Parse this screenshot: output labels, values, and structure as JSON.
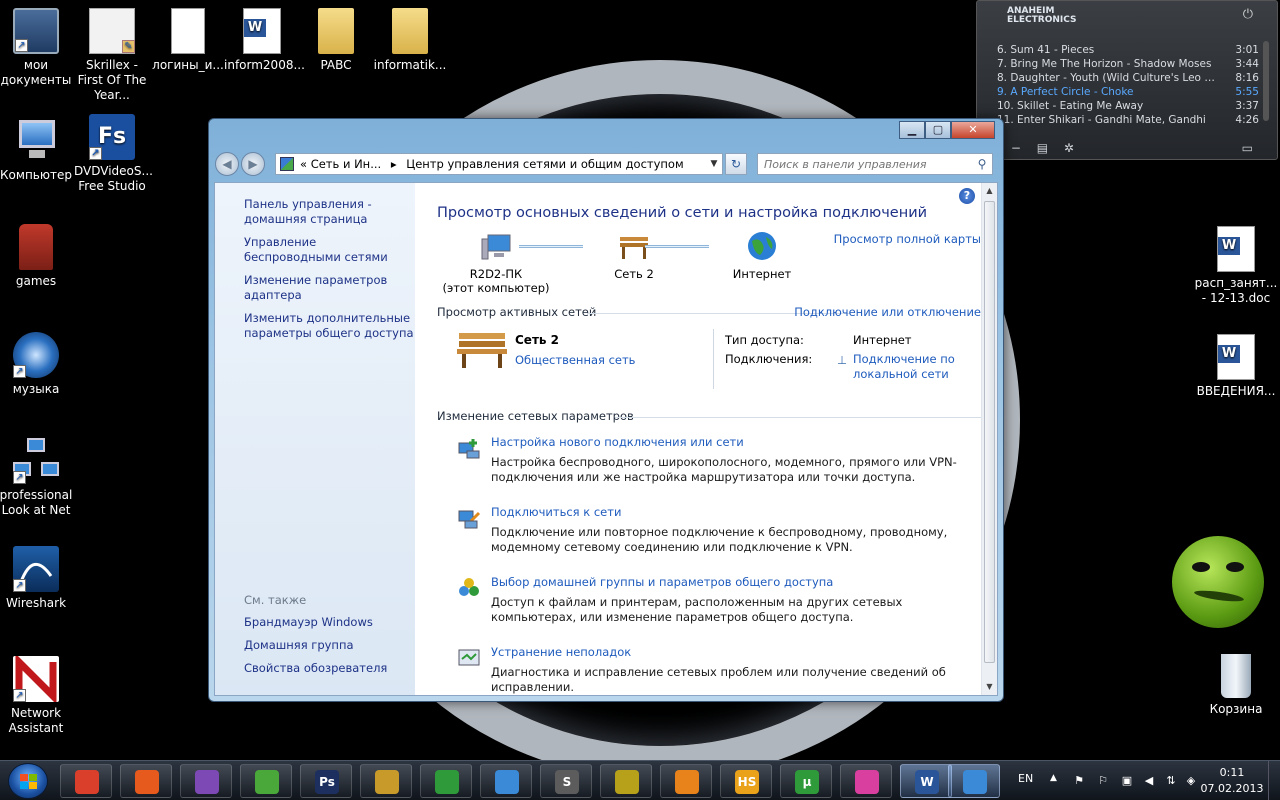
{
  "desktop": {
    "left_icons": [
      {
        "label": "мои документы"
      },
      {
        "label": "Skrillex - First Of The Year..."
      },
      {
        "label": "логины_и..."
      },
      {
        "label": "inform2008..."
      },
      {
        "label": "PABC"
      },
      {
        "label": "informatik..."
      },
      {
        "label": "Компьютер"
      },
      {
        "label": "DVDVideoS... Free Studio"
      },
      {
        "label": "games"
      },
      {
        "label": "музыка"
      },
      {
        "label": "professional Look at Net"
      },
      {
        "label": "Wireshark"
      },
      {
        "label": "Network Assistant"
      }
    ],
    "right_icons": [
      {
        "label": "расп_занят... - 12-13.doc"
      },
      {
        "label": "ВВЕДЕНИЯ..."
      },
      {
        "label": "Корзина"
      }
    ]
  },
  "player": {
    "brand_line1": "ANAHEIM",
    "brand_line2": "ELECTRONICS",
    "tracks": [
      {
        "title": "6. Sum 41 - Pieces",
        "time": "3:01"
      },
      {
        "title": "7. Bring Me The Horizon - Shadow Moses",
        "time": "3:44"
      },
      {
        "title": "8. Daughter - Youth (Wild Culture's Leo Craz...",
        "time": "8:16"
      },
      {
        "title": "9. A Perfect Circle - Choke",
        "time": "5:55"
      },
      {
        "title": "10. Skillet - Eating Me Away",
        "time": "3:37"
      },
      {
        "title": "11. Enter Shikari - Gandhi Mate, Gandhi",
        "time": "4:26"
      }
    ],
    "active_index": 3,
    "active_color": "#5aa9ff"
  },
  "window": {
    "address": {
      "prefix": "«",
      "crumb1": "Сеть и Ин...",
      "separator": "▸",
      "crumb2": "Центр управления сетями и общим доступом"
    },
    "search_placeholder": "Поиск в панели управления",
    "left_nav": {
      "links": [
        "Панель управления - домашняя страница",
        "Управление беспроводными сетями",
        "Изменение параметров адаптера",
        "Изменить дополнительные параметры общего доступа"
      ],
      "see_also_caption": "См. также",
      "see_also": [
        "Брандмауэр Windows",
        "Домашняя группа",
        "Свойства обозревателя"
      ]
    },
    "main": {
      "title": "Просмотр основных сведений о сети и настройка подключений",
      "full_map_link": "Просмотр полной карты",
      "nodes": {
        "computer_line1": "R2D2-ПК",
        "computer_line2": "(этот компьютер)",
        "network": "Сеть  2",
        "internet": "Интернет"
      },
      "active_header": "Просмотр активных сетей",
      "connect_link": "Подключение или отключение",
      "active_network": {
        "name": "Сеть  2",
        "type": "Общественная сеть",
        "access_label": "Тип доступа:",
        "access_value": "Интернет",
        "connections_label": "Подключения:",
        "connections_value": "Подключение по локальной сети"
      },
      "change_header": "Изменение сетевых параметров",
      "tasks": [
        {
          "link": "Настройка нового подключения или сети",
          "desc": "Настройка беспроводного, широкополосного, модемного, прямого или VPN-подключения или же настройка маршрутизатора или точки доступа."
        },
        {
          "link": "Подключиться к сети",
          "desc": "Подключение или повторное подключение к беспроводному, проводному, модемному сетевому соединению или подключение к VPN."
        },
        {
          "link": "Выбор домашней группы и параметров общего доступа",
          "desc": "Доступ к файлам и принтерам, расположенным на других сетевых компьютерах, или изменение параметров общего доступа."
        },
        {
          "link": "Устранение неполадок",
          "desc": "Диагностика и исправление сетевых проблем или получение сведений об исправлении."
        }
      ]
    }
  },
  "taskbar": {
    "apps": [
      {
        "name": "chrome-icon",
        "glyph": "",
        "color": "#d93f2b"
      },
      {
        "name": "burning-icon",
        "glyph": "",
        "color": "#e65a1e"
      },
      {
        "name": "visual-studio-icon",
        "glyph": "",
        "color": "#7d4ab5"
      },
      {
        "name": "download-icon",
        "glyph": "",
        "color": "#4aa83a"
      },
      {
        "name": "photoshop-icon",
        "glyph": "Ps",
        "color": "#1c2f5e"
      },
      {
        "name": "winamp-icon",
        "glyph": "",
        "color": "#c79a2a"
      },
      {
        "name": "xfire-icon",
        "glyph": "",
        "color": "#2e9a3a"
      },
      {
        "name": "music-notes-icon",
        "glyph": "",
        "color": "#3a8ad8"
      },
      {
        "name": "sublime-icon",
        "glyph": "S",
        "color": "#5c5c5c"
      },
      {
        "name": "game-icon",
        "glyph": "",
        "color": "#b7a11a"
      },
      {
        "name": "vlc-icon",
        "glyph": "",
        "color": "#e8821a"
      },
      {
        "name": "hotspot-icon",
        "glyph": "HS",
        "color": "#e9a21a"
      },
      {
        "name": "utorrent-icon",
        "glyph": "µ",
        "color": "#2e9a3a"
      },
      {
        "name": "app-pink-icon",
        "glyph": "",
        "color": "#d93f9e"
      },
      {
        "name": "word-icon",
        "glyph": "W",
        "color": "#2a5699"
      },
      {
        "name": "control-panel-icon",
        "glyph": "",
        "color": "#3a8ad8"
      }
    ],
    "language": "EN",
    "time": "0:11",
    "date": "07.02.2013"
  }
}
